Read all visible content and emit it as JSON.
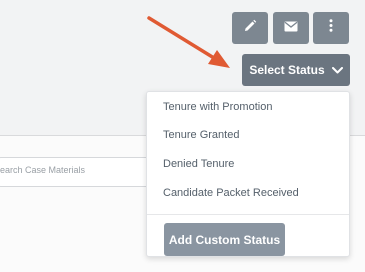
{
  "toolbar": {
    "edit_icon": "pencil-icon",
    "email_icon": "envelope-icon",
    "more_icon": "vertical-dots-icon"
  },
  "status_button": {
    "label": "Select Status",
    "icon": "chevron-down-icon"
  },
  "dropdown": {
    "items": [
      {
        "label": "Tenure with Promotion"
      },
      {
        "label": "Tenure Granted"
      },
      {
        "label": "Denied Tenure"
      },
      {
        "label": "Candidate Packet Received"
      }
    ],
    "add_button_label": "Add Custom Status"
  },
  "search": {
    "placeholder": "earch Case Materials"
  },
  "colors": {
    "button_gray": "#7d8791",
    "status_button": "#6b7580",
    "add_button": "#8a95a1",
    "arrow": "#e05a33",
    "accent_blue": "#4b86c4"
  }
}
